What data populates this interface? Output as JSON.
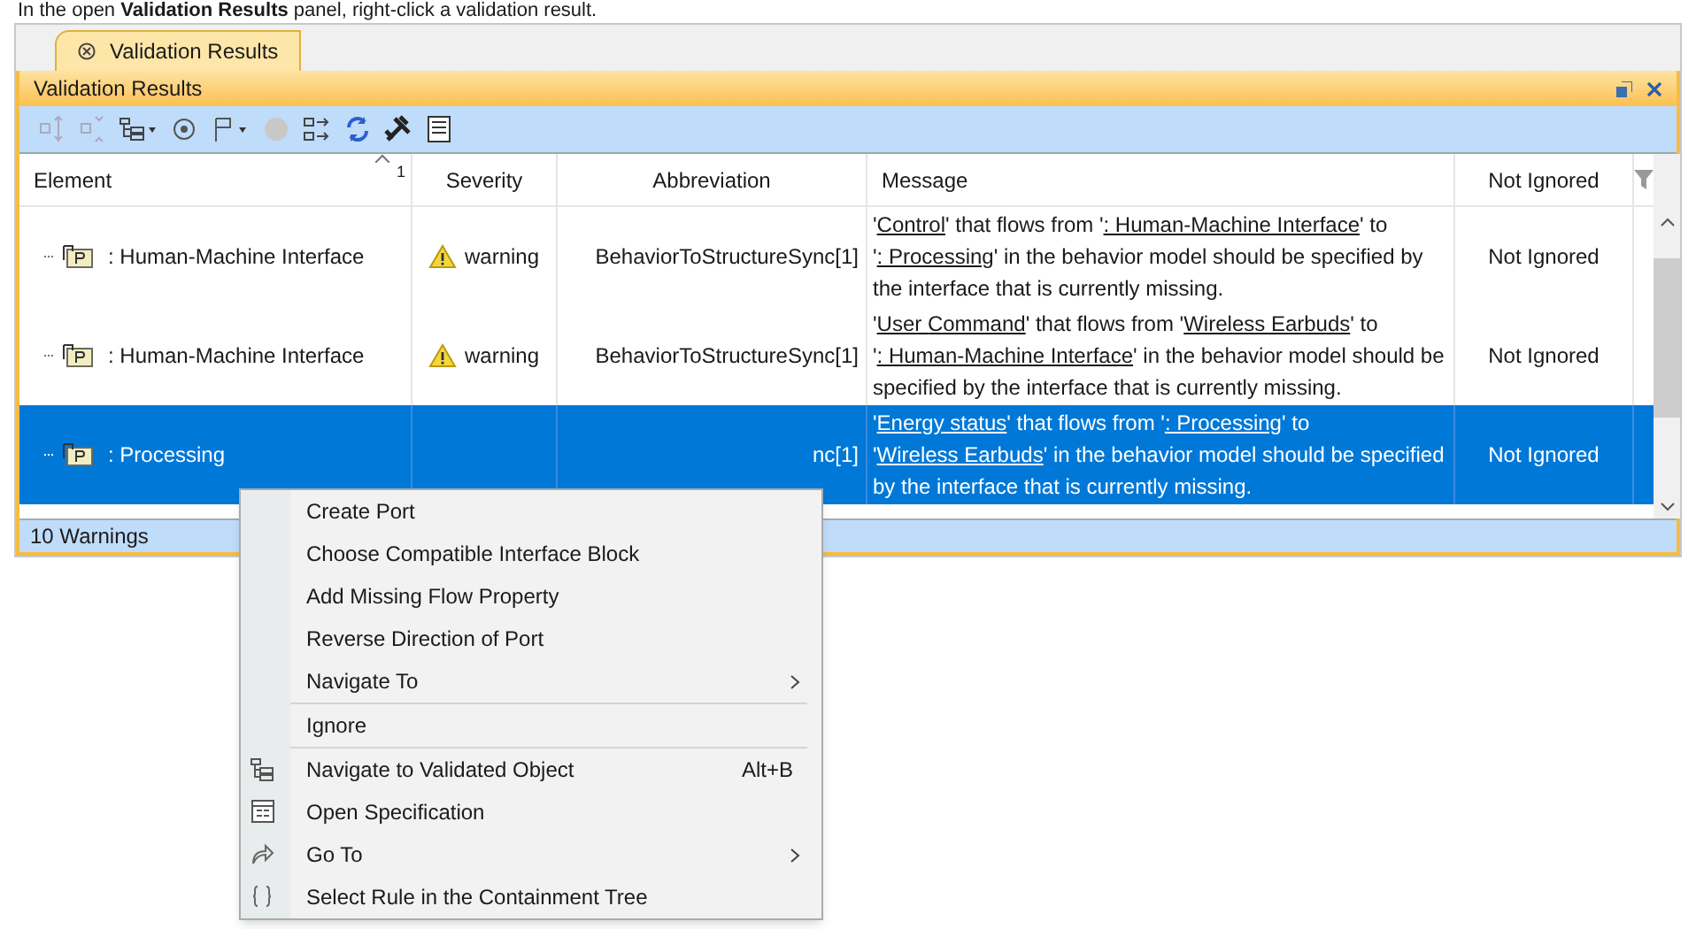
{
  "instruction": "In the open **Validation Results** panel, right-click a validation result.",
  "tab": {
    "label": "Validation Results",
    "selected": true
  },
  "panel": {
    "title": "Validation Results"
  },
  "table": {
    "columns": [
      {
        "label": "Element",
        "sort_mark": "1"
      },
      {
        "label": "Severity"
      },
      {
        "label": "Abbreviation"
      },
      {
        "label": "Message"
      },
      {
        "label": "Not Ignored"
      }
    ],
    "rows": [
      {
        "selected": false,
        "element": ": Human-Machine Interface",
        "severity": "warning",
        "abbreviation": "BehaviorToStructureSync[1]",
        "message": [
          {
            "text": "'",
            "link": false
          },
          {
            "text": "Control",
            "link": true
          },
          {
            "text": "' that flows from '",
            "link": false
          },
          {
            "text": ": Human-Machine Interface",
            "link": true
          },
          {
            "text": "' to '",
            "link": false
          },
          {
            "text": ": Processing",
            "link": true
          },
          {
            "text": "' in the behavior model should be specified by the interface that is currently missing.",
            "link": false
          }
        ],
        "ignored": "Not Ignored"
      },
      {
        "selected": false,
        "element": ": Human-Machine Interface",
        "severity": "warning",
        "abbreviation": "BehaviorToStructureSync[1]",
        "message": [
          {
            "text": "'",
            "link": false
          },
          {
            "text": "User Command",
            "link": true
          },
          {
            "text": "' that flows from '",
            "link": false
          },
          {
            "text": "Wireless Earbuds",
            "link": true
          },
          {
            "text": "' to '",
            "link": false
          },
          {
            "text": ": Human-Machine Interface",
            "link": true
          },
          {
            "text": "' in the behavior model should be specified by the interface that is currently missing.",
            "link": false
          }
        ],
        "ignored": "Not Ignored"
      },
      {
        "selected": true,
        "element": ": Processing",
        "abbreviation": "nc[1]",
        "message": [
          {
            "text": "'",
            "link": false
          },
          {
            "text": "Energy status",
            "link": true
          },
          {
            "text": "' that flows from '",
            "link": false
          },
          {
            "text": ": Processing",
            "link": true
          },
          {
            "text": "' to '",
            "link": false
          },
          {
            "text": "Wireless Earbuds",
            "link": true
          },
          {
            "text": "' in the behavior model should be specified by the interface that is currently missing.",
            "link": false
          }
        ],
        "ignored": "Not Ignored"
      }
    ]
  },
  "status_bar": "10 Warnings",
  "context_menu": {
    "groups": [
      [
        {
          "label": "Create Port"
        },
        {
          "label": "Choose Compatible Interface Block"
        },
        {
          "label": "Add Missing Flow Property"
        },
        {
          "label": "Reverse Direction of Port"
        },
        {
          "label": "Navigate To",
          "submenu": true
        }
      ],
      [
        {
          "label": "Ignore"
        }
      ],
      [
        {
          "label": "Navigate to Validated Object",
          "kind": "tree",
          "shortcut": "Alt+B"
        },
        {
          "label": "Open Specification",
          "kind": "document"
        },
        {
          "label": "Go To",
          "kind": "arrow",
          "submenu": true
        },
        {
          "label": "Select Rule in the Containment Tree",
          "kind": "braces"
        }
      ]
    ]
  }
}
